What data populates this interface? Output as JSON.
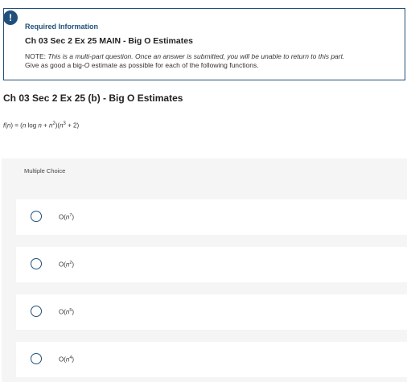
{
  "alert": {
    "icon": "exclamation-icon",
    "glyph": "!"
  },
  "info": {
    "heading": "Required Information",
    "title": "Ch 03 Sec 2 Ex 25 MAIN - Big O Estimates",
    "note_prefix": "NOTE: ",
    "note_italic": "This is a multi-part question. Once an answer is submitted, you will be unable to return to this part.",
    "note_line2_a": "Give as good a big-",
    "note_line2_o": "O",
    "note_line2_b": " estimate as possible for each of the following functions."
  },
  "question": {
    "title": "Ch 03 Sec 2 Ex 25 (b) - Big O Estimates",
    "formula": {
      "f": "f",
      "open": "(",
      "n1": "n",
      "eq": ") = (",
      "n2": "n",
      "log": " log ",
      "n3": "n",
      "plus": " + ",
      "n4": "n",
      "exp2": "2",
      "mid": ")(",
      "n5": "n",
      "exp3": "3",
      "tail": " + 2)"
    }
  },
  "multiple_choice": {
    "label": "Multiple Choice",
    "options": [
      {
        "prefix": "O(",
        "var": "n",
        "exp": "7",
        "suffix": ")"
      },
      {
        "prefix": "O(",
        "var": "n",
        "exp": "2",
        "suffix": ")"
      },
      {
        "prefix": "O(",
        "var": "n",
        "exp": "5",
        "suffix": ")"
      },
      {
        "prefix": "O(",
        "var": "n",
        "exp": "4",
        "suffix": ")"
      }
    ]
  },
  "colors": {
    "accent": "#1f4f7a",
    "panel": "#f5f5f5"
  }
}
